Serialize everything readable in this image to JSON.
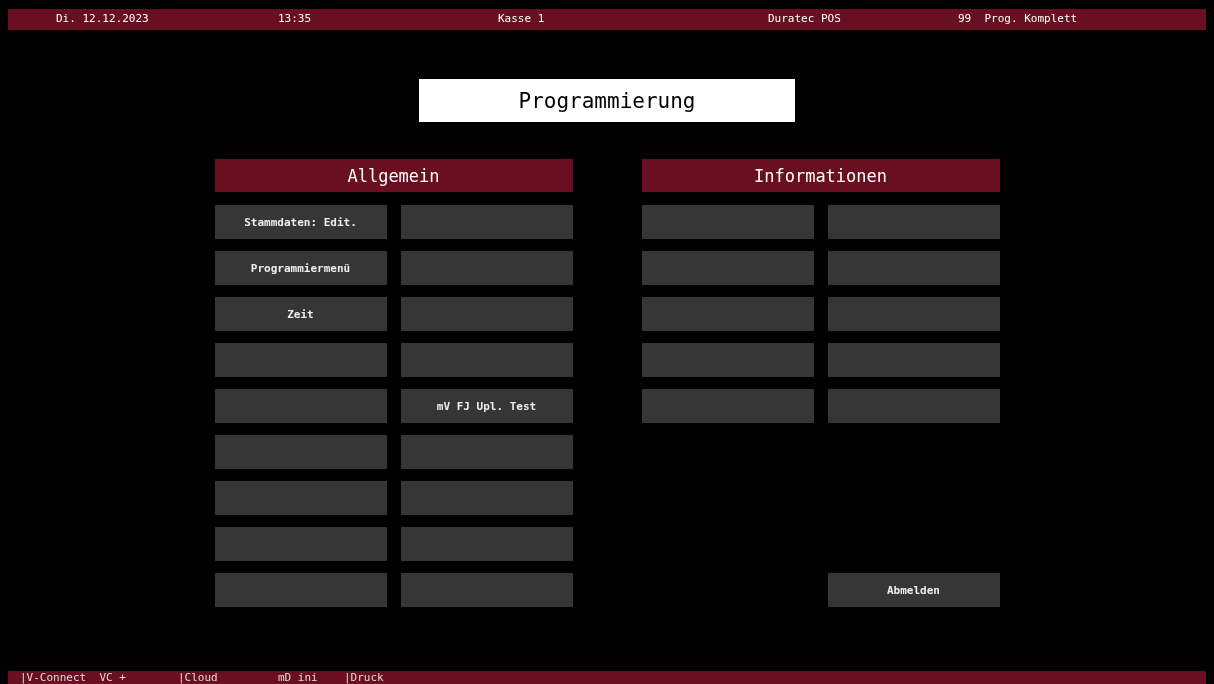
{
  "status_bar": {
    "items": [
      {
        "text": "Di. 12.12.2023"
      },
      {
        "text": "13:35"
      },
      {
        "text": "Kasse 1"
      },
      {
        "text": "Duratec POS"
      },
      {
        "text": "99  Prog. Komplett"
      }
    ]
  },
  "title": "Programmierung",
  "sections": [
    {
      "title": "Allgemein",
      "rows": [
        [
          {
            "kind": "button",
            "label": "Stammdaten: Edit."
          },
          {
            "kind": "button"
          }
        ],
        [
          {
            "kind": "button",
            "label": "Programmiermenü"
          },
          {
            "kind": "button"
          }
        ],
        [
          {
            "kind": "button",
            "label": "Zeit"
          },
          {
            "kind": "button"
          }
        ],
        [
          {
            "kind": "button"
          },
          {
            "kind": "button"
          }
        ],
        [
          {
            "kind": "button"
          },
          {
            "kind": "button",
            "label": "mV FJ Upl. Test"
          }
        ],
        [
          {
            "kind": "button"
          },
          {
            "kind": "button"
          }
        ],
        [
          {
            "kind": "button"
          },
          {
            "kind": "button"
          }
        ],
        [
          {
            "kind": "button"
          },
          {
            "kind": "button"
          }
        ],
        [
          {
            "kind": "button"
          },
          {
            "kind": "button"
          }
        ]
      ]
    },
    {
      "title": "Informationen",
      "rows": [
        [
          {
            "kind": "button"
          },
          {
            "kind": "button"
          }
        ],
        [
          {
            "kind": "button"
          },
          {
            "kind": "button"
          }
        ],
        [
          {
            "kind": "button"
          },
          {
            "kind": "button"
          }
        ],
        [
          {
            "kind": "button"
          },
          {
            "kind": "button"
          }
        ],
        [
          {
            "kind": "button"
          },
          {
            "kind": "button"
          }
        ],
        [
          {
            "kind": "spacer"
          },
          {
            "kind": "spacer"
          }
        ],
        [
          {
            "kind": "spacer"
          },
          {
            "kind": "spacer"
          }
        ],
        [
          {
            "kind": "spacer"
          },
          {
            "kind": "spacer"
          }
        ],
        [
          {
            "kind": "spacer"
          },
          {
            "kind": "button",
            "label": "Abmelden"
          }
        ]
      ]
    }
  ],
  "bottom_bar": {
    "items": [
      {
        "text": "|V-Connect  VC +"
      },
      {
        "text": "|Cloud"
      },
      {
        "text": "mD ini"
      },
      {
        "text": "|Druck"
      }
    ]
  }
}
